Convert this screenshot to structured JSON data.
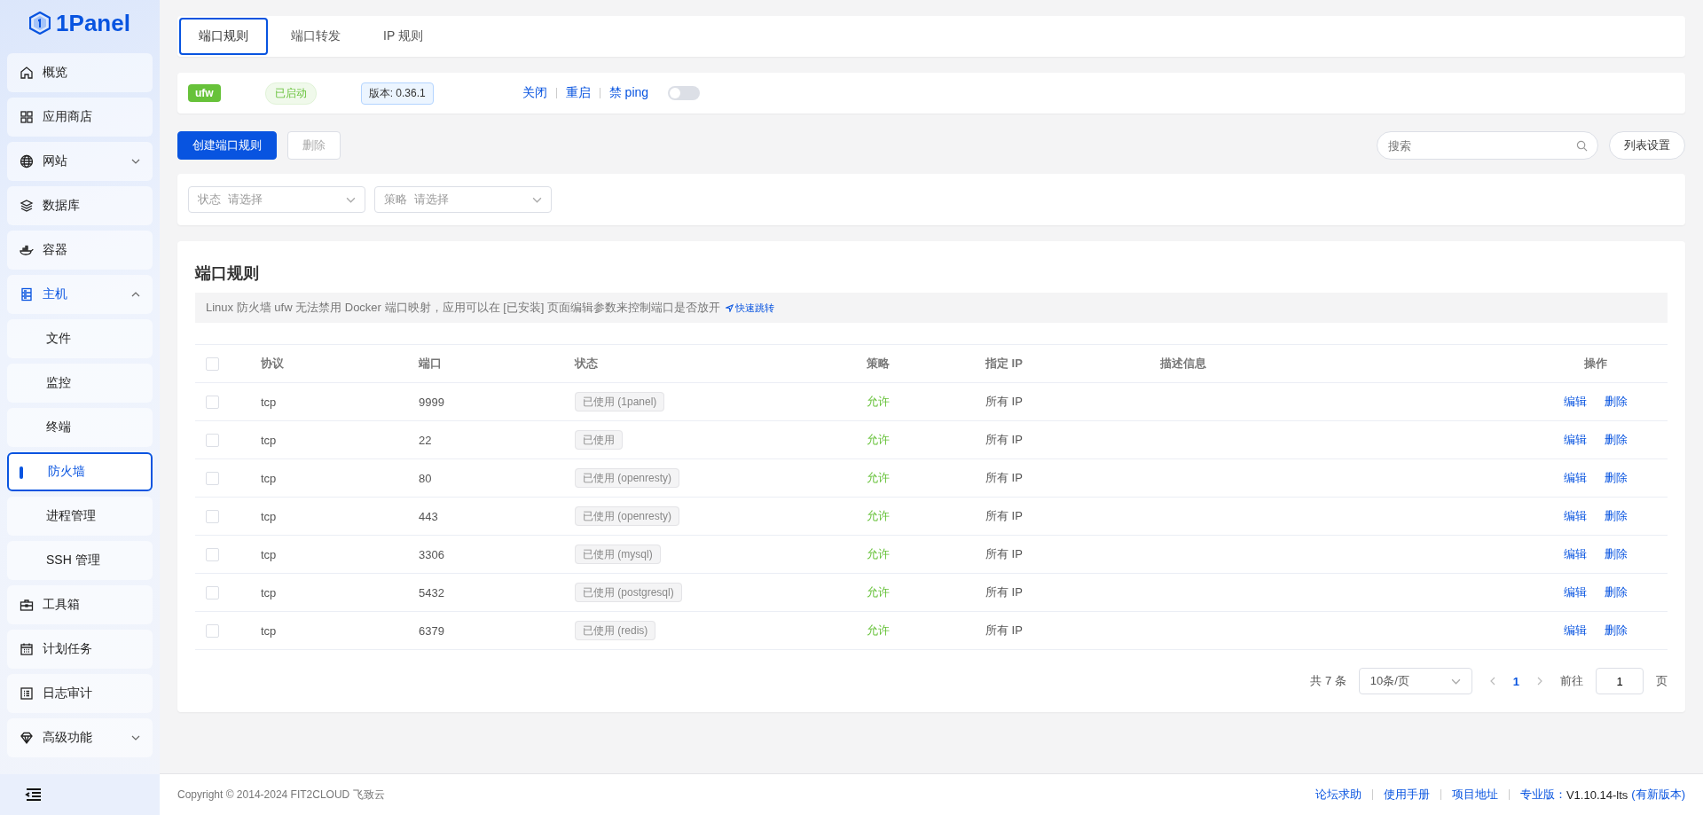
{
  "sidebar": {
    "logo": "1Panel",
    "items": [
      {
        "label": "概览",
        "selected": false
      },
      {
        "label": "应用商店",
        "selected": false
      },
      {
        "label": "网站",
        "selected": false,
        "expanded": false
      },
      {
        "label": "数据库",
        "selected": false
      },
      {
        "label": "容器",
        "selected": false
      },
      {
        "label": "主机",
        "expanded": true,
        "children": [
          {
            "label": "文件",
            "selected": false
          },
          {
            "label": "监控",
            "selected": false
          },
          {
            "label": "终端",
            "selected": false
          },
          {
            "label": "防火墙",
            "selected": true
          },
          {
            "label": "进程管理",
            "selected": false
          },
          {
            "label": "SSH 管理",
            "selected": false
          }
        ]
      },
      {
        "label": "工具箱",
        "selected": false
      },
      {
        "label": "计划任务",
        "selected": false
      },
      {
        "label": "日志审计",
        "selected": false
      },
      {
        "label": "高级功能",
        "selected": false,
        "expanded": false
      }
    ]
  },
  "tabs": [
    {
      "label": "端口规则",
      "selected": true
    },
    {
      "label": "端口转发",
      "selected": false
    },
    {
      "label": "IP 规则",
      "selected": false
    }
  ],
  "status": {
    "name": "ufw",
    "state": "已启动",
    "version": "版本: 0.36.1",
    "actions": [
      "关闭",
      "重启",
      "禁 ping"
    ],
    "ping_toggle": {
      "on": false
    }
  },
  "toolbar": {
    "create": "创建端口规则",
    "delete": "删除",
    "search_placeholder": "搜索",
    "list_settings": "列表设置"
  },
  "filters": [
    {
      "label": "状态",
      "placeholder": "请选择"
    },
    {
      "label": "策略",
      "placeholder": "请选择"
    }
  ],
  "card": {
    "title": "端口规则",
    "notice": "Linux 防火墙 ufw 无法禁用 Docker 端口映射，应用可以在 [已安装] 页面编辑参数来控制端口是否放开",
    "notice_link": "快速跳转"
  },
  "table": {
    "select_all": {
      "checked": false
    },
    "columns": [
      "协议",
      "端口",
      "状态",
      "策略",
      "指定 IP",
      "描述信息",
      "操作"
    ],
    "rows": [
      {
        "checked": false,
        "protocol": "tcp",
        "port": "9999",
        "status": "已使用 (1panel)",
        "policy": "允许",
        "ip": "所有 IP",
        "actions": [
          "编辑",
          "删除"
        ]
      },
      {
        "checked": false,
        "protocol": "tcp",
        "port": "22",
        "status": "已使用",
        "policy": "允许",
        "ip": "所有 IP",
        "actions": [
          "编辑",
          "删除"
        ]
      },
      {
        "checked": false,
        "protocol": "tcp",
        "port": "80",
        "status": "已使用 (openresty)",
        "policy": "允许",
        "ip": "所有 IP",
        "actions": [
          "编辑",
          "删除"
        ]
      },
      {
        "checked": false,
        "protocol": "tcp",
        "port": "443",
        "status": "已使用 (openresty)",
        "policy": "允许",
        "ip": "所有 IP",
        "actions": [
          "编辑",
          "删除"
        ]
      },
      {
        "checked": false,
        "protocol": "tcp",
        "port": "3306",
        "status": "已使用 (mysql)",
        "policy": "允许",
        "ip": "所有 IP",
        "actions": [
          "编辑",
          "删除"
        ]
      },
      {
        "checked": false,
        "protocol": "tcp",
        "port": "5432",
        "status": "已使用 (postgresql)",
        "policy": "允许",
        "ip": "所有 IP",
        "actions": [
          "编辑",
          "删除"
        ]
      },
      {
        "checked": false,
        "protocol": "tcp",
        "port": "6379",
        "status": "已使用 (redis)",
        "policy": "允许",
        "ip": "所有 IP",
        "actions": [
          "编辑",
          "删除"
        ]
      }
    ]
  },
  "pagination": {
    "total": "共 7 条",
    "page_size": "10条/页",
    "pages": [
      {
        "label": "1",
        "selected": true
      }
    ],
    "goto_label": "前往",
    "goto_value": "1",
    "unit": "页"
  },
  "footer": {
    "copyright": "Copyright © 2014-2024 FIT2CLOUD 飞致云",
    "links": [
      "论坛求助",
      "使用手册",
      "项目地址"
    ],
    "edition_label": "专业版：",
    "version": "V1.10.14-lts",
    "update": "(有新版本)"
  }
}
